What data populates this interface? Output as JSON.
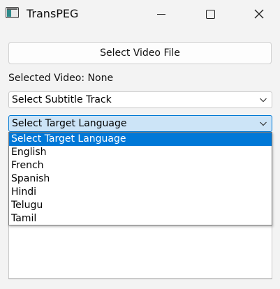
{
  "window": {
    "title": "TransPEG"
  },
  "main": {
    "select_video_label": "Select Video File",
    "selected_video_text": "Selected Video: None",
    "subtitle_combo_value": "Select Subtitle Track",
    "language_combo_value": "Select Target Language"
  },
  "language_dropdown": {
    "options": [
      "Select Target Language",
      "English",
      "French",
      "Spanish",
      "Hindi",
      "Telugu",
      "Tamil"
    ],
    "highlighted_index": 0
  },
  "colors": {
    "selection": "#0078d7",
    "combo_focus_bg": "#cce4f7",
    "combo_focus_border": "#0078d4"
  },
  "icons": [
    "app-icon",
    "minimize-icon",
    "maximize-icon",
    "close-icon",
    "chevron-down-icon"
  ]
}
